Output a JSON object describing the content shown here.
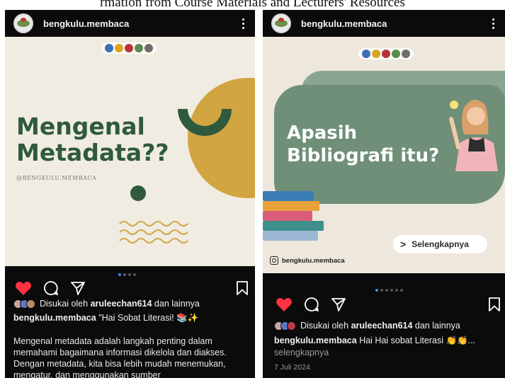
{
  "top_strip_text": "rmation from Course Materials and Lecturers' Resources",
  "left_post": {
    "username": "bengkulu.membaca",
    "title_line1": "Mengenal",
    "title_line2": "Metadata??",
    "image_handle": "@BENGKULU.MEMBACA",
    "liked_prefix": "Disukai oleh",
    "liked_user": "aruleechan614",
    "liked_suffix": "dan lainnya",
    "caption_user": "bengkulu.membaca",
    "caption_text": "\"Hai Sobat Literasi! 📚✨",
    "body_text": "Mengenal metadata adalah langkah penting dalam memahami bagaimana informasi dikelola dan diakses. Dengan metadata, kita bisa lebih mudah menemukan, mengatur, dan menggunakan sumber"
  },
  "right_post": {
    "username": "bengkulu.membaca",
    "title_line1": "Apasih",
    "title_line2": "Bibliografi itu?",
    "cta_label": "Selengkapnya",
    "image_handle": "bengkulu.membaca",
    "liked_prefix": "Disukai oleh",
    "liked_user": "aruleechan614",
    "liked_suffix": "dan lainnya",
    "caption_user": "bengkulu.membaca",
    "caption_text": "Hai Hai sobat Literasi 👏👏...",
    "see_more": "selengkapnya",
    "date": "7 Juli 2024"
  },
  "colors": {
    "like_red": "#ff3040",
    "dark_green": "#2f5a3d",
    "mustard": "#d2a540",
    "sage": "#6f8f78",
    "active_dot": "#3d8af7"
  },
  "icons": [
    "heart-icon",
    "comment-icon",
    "share-icon",
    "bookmark-icon",
    "more-options-icon",
    "chevron-right-icon",
    "instagram-icon"
  ]
}
